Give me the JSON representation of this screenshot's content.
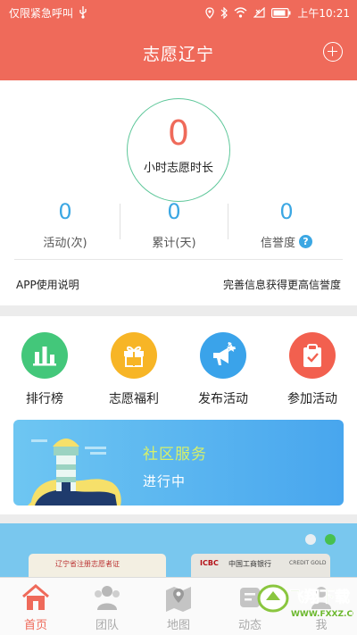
{
  "status_bar": {
    "carrier_text": "仅限紧急呼叫",
    "time": "上午10:21"
  },
  "header": {
    "title": "志愿辽宁",
    "add_icon": "plus-circle-icon"
  },
  "stats": {
    "hours_value": "0",
    "hours_label": "小时志愿时长",
    "metrics": [
      {
        "value": "0",
        "label": "活动(次)"
      },
      {
        "value": "0",
        "label": "累计(天)"
      },
      {
        "value": "0",
        "label": "信誉度"
      }
    ],
    "help_glyph": "?",
    "app_guide": "APP使用说明",
    "improve_link": "完善信息获得更高信誉度"
  },
  "actions": [
    {
      "label": "排行榜",
      "icon": "ranking-icon",
      "color": "#43c77a"
    },
    {
      "label": "志愿福利",
      "icon": "gift-icon",
      "color": "#f7b526"
    },
    {
      "label": "发布活动",
      "icon": "megaphone-icon",
      "color": "#3aa3ea"
    },
    {
      "label": "参加活动",
      "icon": "clipboard-icon",
      "color": "#f2604f"
    }
  ],
  "banner": {
    "title": "社区服务",
    "subtitle": "进行中"
  },
  "carousel": {
    "card1_text": "辽宁省注册志愿者证",
    "card2_brand": "ICBC",
    "card2_text": "中国工商银行",
    "card2_tag": "CREDIT GOLD",
    "active_index": 1
  },
  "tabbar": [
    {
      "label": "首页",
      "icon": "home-icon",
      "active": true
    },
    {
      "label": "团队",
      "icon": "team-icon",
      "active": false
    },
    {
      "label": "地图",
      "icon": "map-icon",
      "active": false
    },
    {
      "label": "动态",
      "icon": "feed-icon",
      "active": false
    },
    {
      "label": "我",
      "icon": "profile-icon",
      "active": false
    }
  ],
  "watermark": {
    "text": "飞翔下载",
    "url": "WWW.FXXZ.COM"
  },
  "colors": {
    "brand": "#ef6a5a",
    "accent_blue": "#3ba7e3",
    "ring_green": "#5ec79a"
  }
}
